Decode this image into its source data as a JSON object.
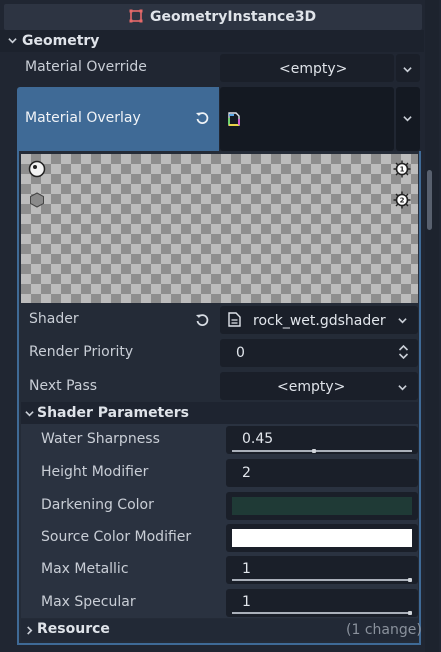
{
  "header": {
    "title": "GeometryInstance3D",
    "node_icon": "geometryinstance3d-icon"
  },
  "sections": {
    "geometry": "Geometry",
    "shader_parameters": "Shader Parameters",
    "resource": "Resource",
    "resource_changes": "(1 change)"
  },
  "geometry": {
    "material_override": {
      "label": "Material Override",
      "value": "<empty>"
    },
    "material_overlay": {
      "label": "Material Overlay"
    }
  },
  "material": {
    "shader": {
      "label": "Shader",
      "value": "rock_wet.gdshader"
    },
    "render_priority": {
      "label": "Render Priority",
      "value": "0"
    },
    "next_pass": {
      "label": "Next Pass",
      "value": "<empty>"
    }
  },
  "shader_params": {
    "water_sharpness": {
      "label": "Water Sharpness",
      "value": "0.45",
      "slider_fraction": 0.45
    },
    "height_modifier": {
      "label": "Height Modifier",
      "value": "2"
    },
    "darkening_color": {
      "label": "Darkening Color",
      "color": "#1f3a36"
    },
    "source_color_modifier": {
      "label": "Source Color Modifier",
      "color": "#ffffff"
    },
    "max_metallic": {
      "label": "Max Metallic",
      "value": "1",
      "slider_fraction": 1.0
    },
    "max_specular": {
      "label": "Max Specular",
      "value": "1",
      "slider_fraction": 1.0
    }
  },
  "colors": {
    "selected_bg": "#3f6a96",
    "accent": "#6da9e6"
  }
}
